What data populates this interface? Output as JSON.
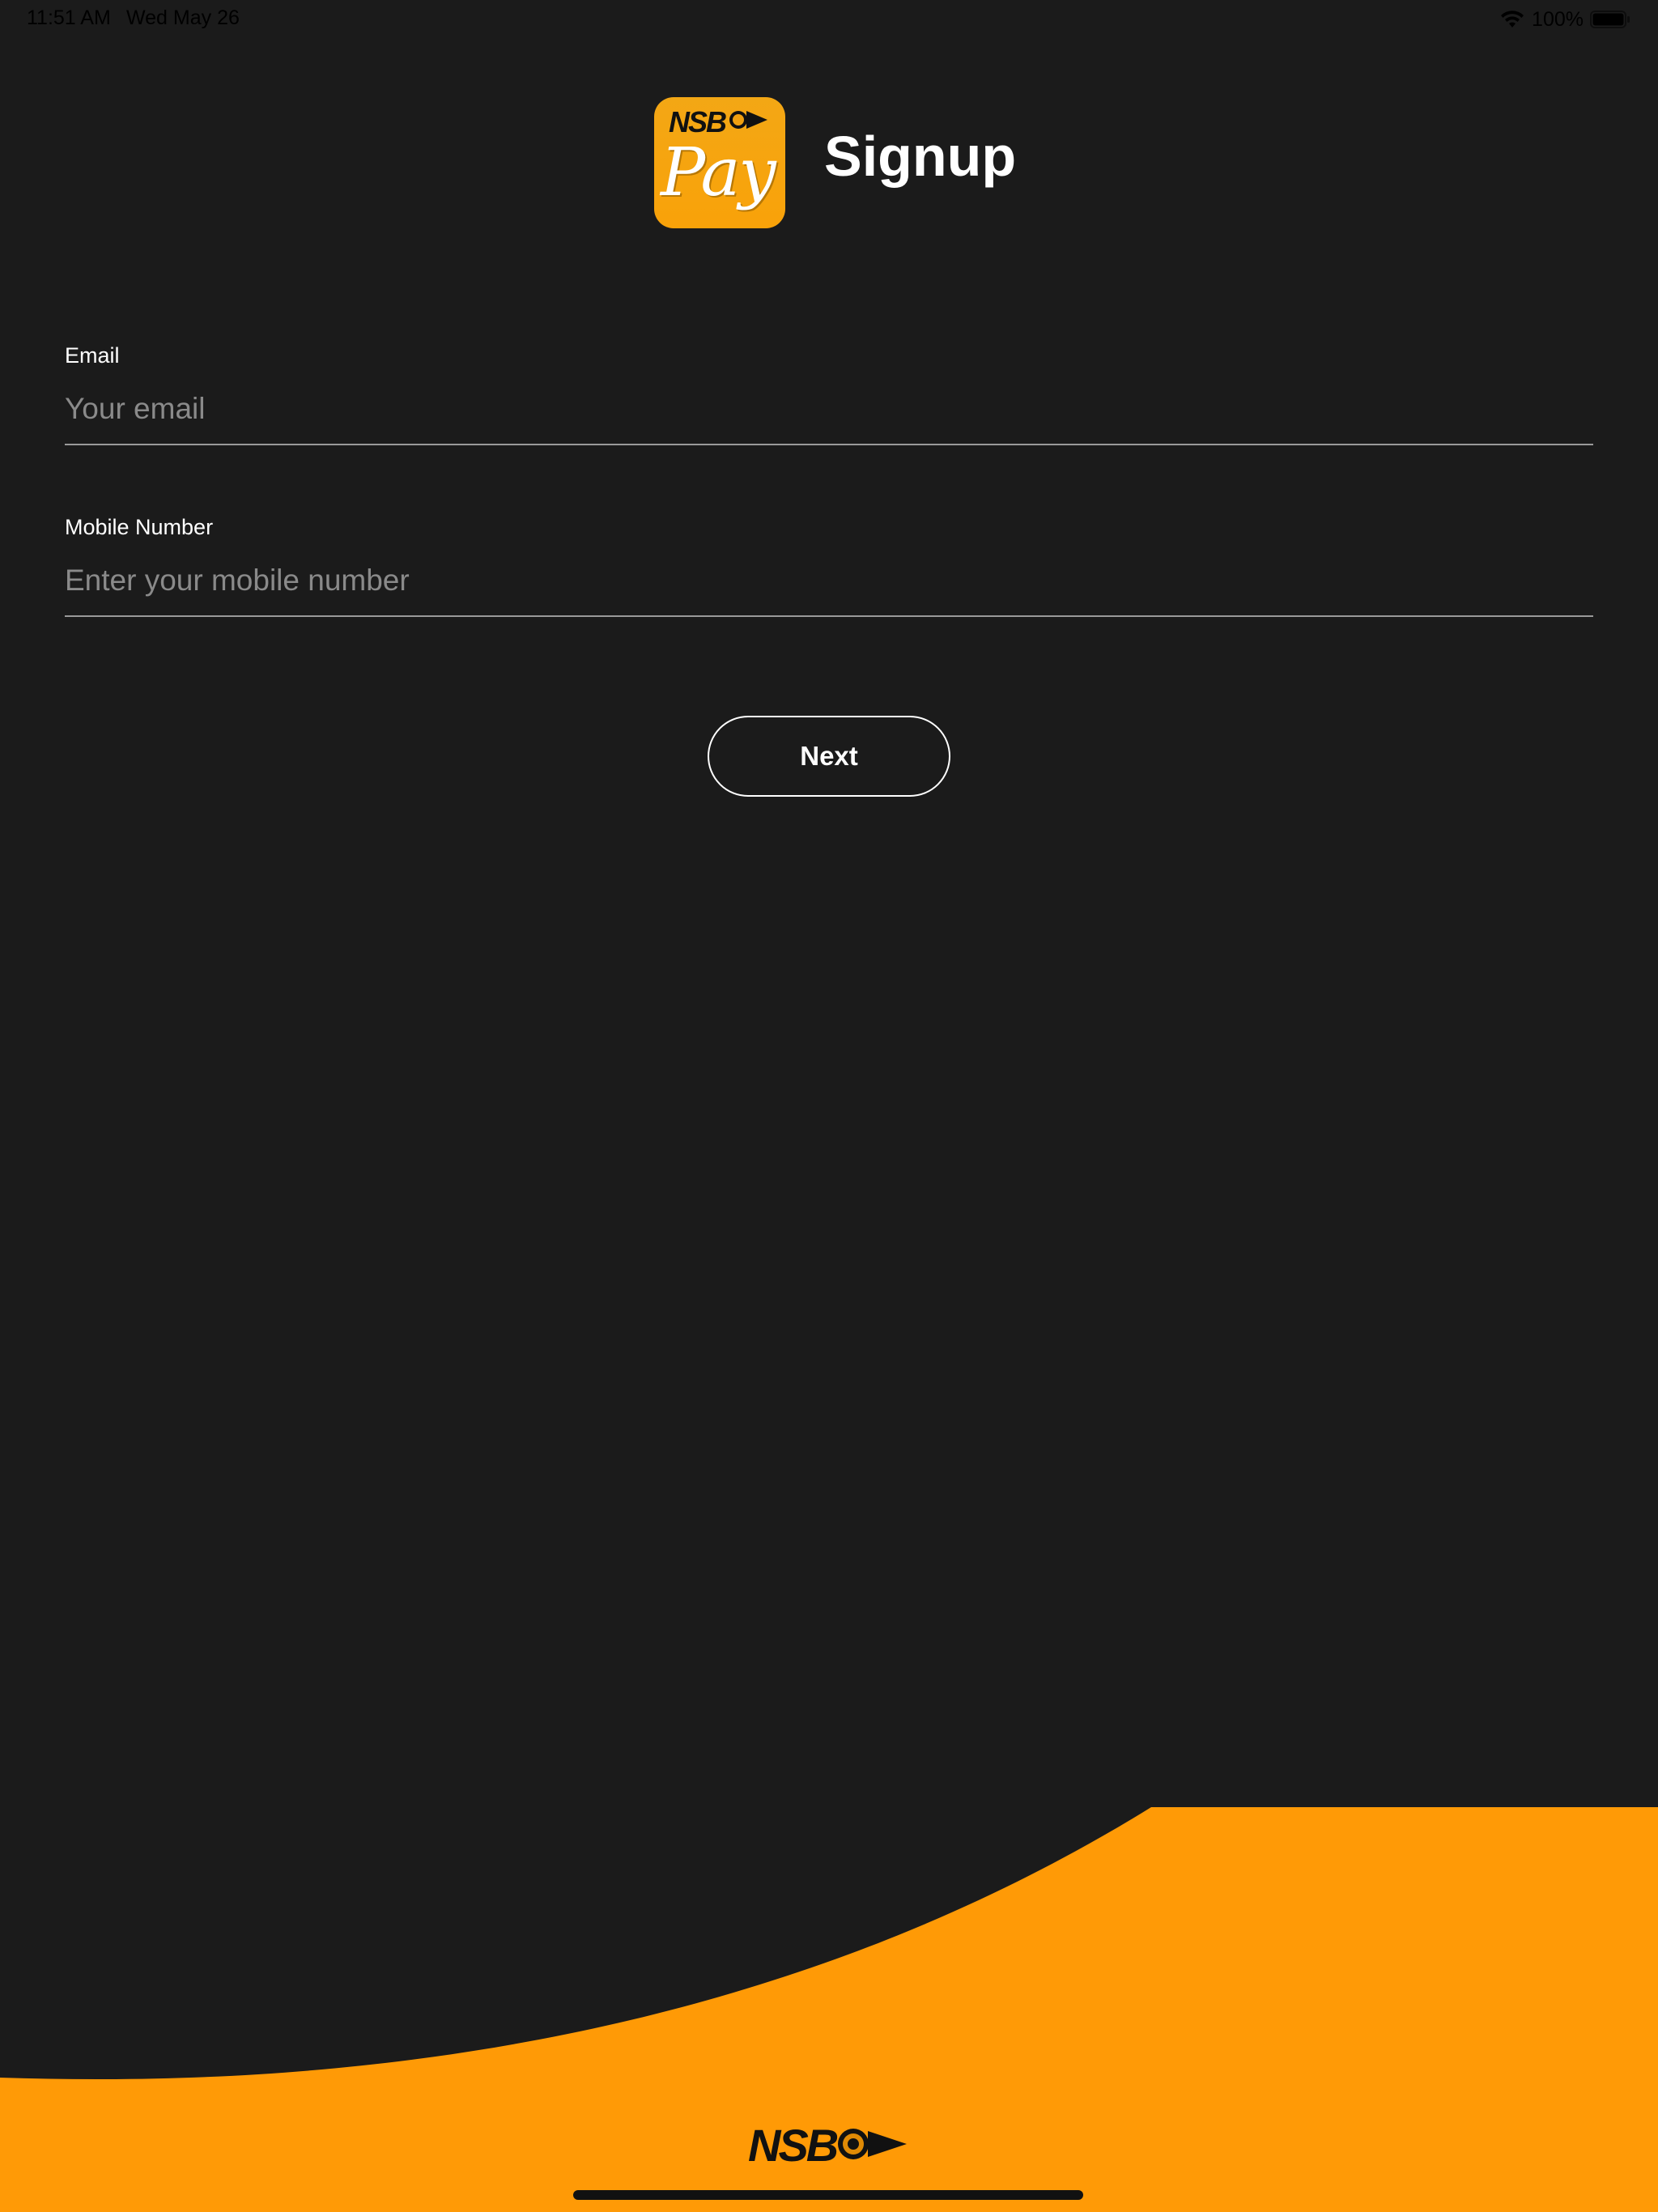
{
  "status_bar": {
    "time": "11:51 AM",
    "date": "Wed May 26",
    "battery": "100%"
  },
  "header": {
    "logo_brand": "NSB",
    "logo_word": "Pay",
    "title": "Signup"
  },
  "form": {
    "email": {
      "label": "Email",
      "placeholder": "Your email",
      "value": ""
    },
    "mobile": {
      "label": "Mobile Number",
      "placeholder": "Enter your mobile number",
      "value": ""
    },
    "next_label": "Next"
  },
  "footer": {
    "brand": "NSB"
  },
  "colors": {
    "background": "#1b1b1b",
    "accent": "#ff9a06",
    "text": "#ffffff",
    "placeholder": "#8a8a8a"
  }
}
